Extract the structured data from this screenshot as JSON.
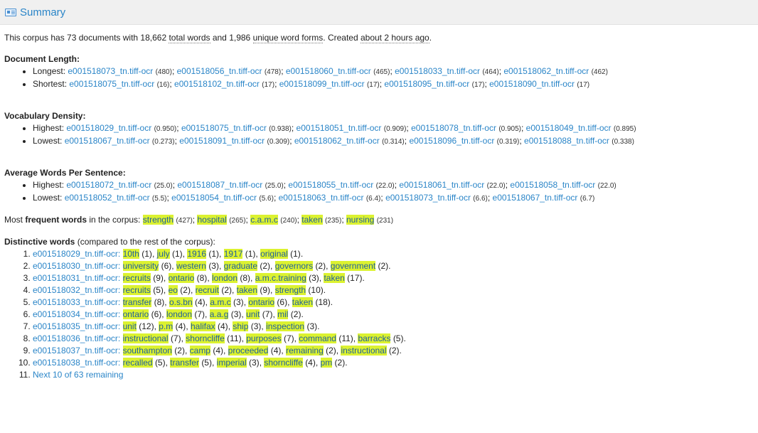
{
  "header": {
    "title": "Summary",
    "icon": "summary-icon"
  },
  "intro": {
    "p1": "This corpus has 73 documents with 18,662 ",
    "total_words_label": "total words",
    "p2": " and 1,986 ",
    "unique_label": "unique word forms",
    "p3": ". Created ",
    "created": "about 2 hours ago",
    "p4": "."
  },
  "doc_length": {
    "heading": "Document Length:",
    "rows": [
      {
        "label": "Longest: ",
        "items": [
          {
            "name": "e001518073_tn.tiff-ocr",
            "val": "(480)"
          },
          {
            "name": "e001518056_tn.tiff-ocr",
            "val": "(478)"
          },
          {
            "name": "e001518060_tn.tiff-ocr",
            "val": "(465)"
          },
          {
            "name": "e001518033_tn.tiff-ocr",
            "val": "(464)"
          },
          {
            "name": "e001518062_tn.tiff-ocr",
            "val": "(462)"
          }
        ]
      },
      {
        "label": "Shortest: ",
        "items": [
          {
            "name": "e001518075_tn.tiff-ocr",
            "val": "(16)"
          },
          {
            "name": "e001518102_tn.tiff-ocr",
            "val": "(17)"
          },
          {
            "name": "e001518099_tn.tiff-ocr",
            "val": "(17)"
          },
          {
            "name": "e001518095_tn.tiff-ocr",
            "val": "(17)"
          },
          {
            "name": "e001518090_tn.tiff-ocr",
            "val": "(17)"
          }
        ]
      }
    ]
  },
  "vocab_density": {
    "heading": "Vocabulary Density:",
    "rows": [
      {
        "label": "Highest: ",
        "items": [
          {
            "name": "e001518029_tn.tiff-ocr",
            "val": "(0.950)"
          },
          {
            "name": "e001518075_tn.tiff-ocr",
            "val": "(0.938)"
          },
          {
            "name": "e001518051_tn.tiff-ocr",
            "val": "(0.909)"
          },
          {
            "name": "e001518078_tn.tiff-ocr",
            "val": "(0.905)"
          },
          {
            "name": "e001518049_tn.tiff-ocr",
            "val": "(0.895)"
          }
        ]
      },
      {
        "label": "Lowest: ",
        "items": [
          {
            "name": "e001518067_tn.tiff-ocr",
            "val": "(0.273)"
          },
          {
            "name": "e001518091_tn.tiff-ocr",
            "val": "(0.309)"
          },
          {
            "name": "e001518062_tn.tiff-ocr",
            "val": "(0.314)"
          },
          {
            "name": "e001518096_tn.tiff-ocr",
            "val": "(0.319)"
          },
          {
            "name": "e001518088_tn.tiff-ocr",
            "val": "(0.338)"
          }
        ]
      }
    ]
  },
  "avg_words": {
    "heading": "Average Words Per Sentence:",
    "rows": [
      {
        "label": "Highest: ",
        "items": [
          {
            "name": "e001518072_tn.tiff-ocr",
            "val": "(25.0)"
          },
          {
            "name": "e001518087_tn.tiff-ocr",
            "val": "(25.0)"
          },
          {
            "name": "e001518055_tn.tiff-ocr",
            "val": "(22.0)"
          },
          {
            "name": "e001518061_tn.tiff-ocr",
            "val": "(22.0)"
          },
          {
            "name": "e001518058_tn.tiff-ocr",
            "val": "(22.0)"
          }
        ]
      },
      {
        "label": "Lowest: ",
        "items": [
          {
            "name": "e001518052_tn.tiff-ocr",
            "val": "(5.5)"
          },
          {
            "name": "e001518054_tn.tiff-ocr",
            "val": "(5.6)"
          },
          {
            "name": "e001518063_tn.tiff-ocr",
            "val": "(6.4)"
          },
          {
            "name": "e001518073_tn.tiff-ocr",
            "val": "(6.6)"
          },
          {
            "name": "e001518067_tn.tiff-ocr",
            "val": "(6.7)"
          }
        ]
      }
    ]
  },
  "frequent": {
    "pre": "Most ",
    "bold": "frequent words",
    "post": " in the corpus: ",
    "words": [
      {
        "w": "strength",
        "c": "(427)"
      },
      {
        "w": "hospital",
        "c": "(265)"
      },
      {
        "w": "c.a.m.c",
        "c": "(240)"
      },
      {
        "w": "taken",
        "c": "(235)"
      },
      {
        "w": "nursing",
        "c": "(231)"
      }
    ]
  },
  "distinctive": {
    "bold": "Distinctive words",
    "post": " (compared to the rest of the corpus):",
    "docs": [
      {
        "doc": "e001518029_tn.tiff-ocr:",
        "words": [
          {
            "w": "10th",
            "c": "(1)"
          },
          {
            "w": "july",
            "c": "(1)"
          },
          {
            "w": "1916",
            "c": "(1)"
          },
          {
            "w": "1917",
            "c": "(1)"
          },
          {
            "w": "original",
            "c": "(1)"
          }
        ]
      },
      {
        "doc": "e001518030_tn.tiff-ocr:",
        "words": [
          {
            "w": "university",
            "c": "(6)"
          },
          {
            "w": "western",
            "c": "(3)"
          },
          {
            "w": "graduate",
            "c": "(2)"
          },
          {
            "w": "governors",
            "c": "(2)"
          },
          {
            "w": "government",
            "c": "(2)"
          }
        ]
      },
      {
        "doc": "e001518031_tn.tiff-ocr:",
        "words": [
          {
            "w": "recruits",
            "c": "(9)"
          },
          {
            "w": "ontario",
            "c": "(8)"
          },
          {
            "w": "london",
            "c": "(8)"
          },
          {
            "w": "a.m.c.training",
            "c": "(3)"
          },
          {
            "w": "taken",
            "c": "(17)"
          }
        ]
      },
      {
        "doc": "e001518032_tn.tiff-ocr:",
        "words": [
          {
            "w": "recruits",
            "c": "(5)"
          },
          {
            "w": "eo",
            "c": "(2)"
          },
          {
            "w": "recruit",
            "c": "(2)"
          },
          {
            "w": "taken",
            "c": "(9)"
          },
          {
            "w": "strength",
            "c": "(10)"
          }
        ]
      },
      {
        "doc": "e001518033_tn.tiff-ocr:",
        "words": [
          {
            "w": "transfer",
            "c": "(8)"
          },
          {
            "w": "o.s.bn",
            "c": "(4)"
          },
          {
            "w": "a.m.c",
            "c": "(3)"
          },
          {
            "w": "ontario",
            "c": "(6)"
          },
          {
            "w": "taken",
            "c": "(18)"
          }
        ]
      },
      {
        "doc": "e001518034_tn.tiff-ocr:",
        "words": [
          {
            "w": "ontario",
            "c": "(6)"
          },
          {
            "w": "london",
            "c": "(7)"
          },
          {
            "w": "a.a.g",
            "c": "(3)"
          },
          {
            "w": "unit",
            "c": "(7)"
          },
          {
            "w": "mil",
            "c": "(2)"
          }
        ]
      },
      {
        "doc": "e001518035_tn.tiff-ocr:",
        "words": [
          {
            "w": "unit",
            "c": "(12)"
          },
          {
            "w": "p.m",
            "c": "(4)"
          },
          {
            "w": "halifax",
            "c": "(4)"
          },
          {
            "w": "ship",
            "c": "(3)"
          },
          {
            "w": "inspection",
            "c": "(3)"
          }
        ]
      },
      {
        "doc": "e001518036_tn.tiff-ocr:",
        "words": [
          {
            "w": "instructional",
            "c": "(7)"
          },
          {
            "w": "shorncliffe",
            "c": "(11)"
          },
          {
            "w": "purposes",
            "c": "(7)"
          },
          {
            "w": "command",
            "c": "(11)"
          },
          {
            "w": "barracks",
            "c": "(5)"
          }
        ]
      },
      {
        "doc": "e001518037_tn.tiff-ocr:",
        "words": [
          {
            "w": "southampton",
            "c": "(2)"
          },
          {
            "w": "camp",
            "c": "(4)"
          },
          {
            "w": "proceeded",
            "c": "(4)"
          },
          {
            "w": "remaining",
            "c": "(2)"
          },
          {
            "w": "instructional",
            "c": "(2)"
          }
        ]
      },
      {
        "doc": "e001518038_tn.tiff-ocr:",
        "words": [
          {
            "w": "recalled",
            "c": "(5)"
          },
          {
            "w": "transfer",
            "c": "(5)"
          },
          {
            "w": "imperial",
            "c": "(3)"
          },
          {
            "w": "shorncliffe",
            "c": "(4)"
          },
          {
            "w": "pm",
            "c": "(2)"
          }
        ]
      }
    ],
    "next_link": "Next 10 of 63 remaining"
  },
  "colors": {
    "link": "#2a85c8",
    "highlight": "#dcf230",
    "header_bg": "#f0f0f0"
  }
}
